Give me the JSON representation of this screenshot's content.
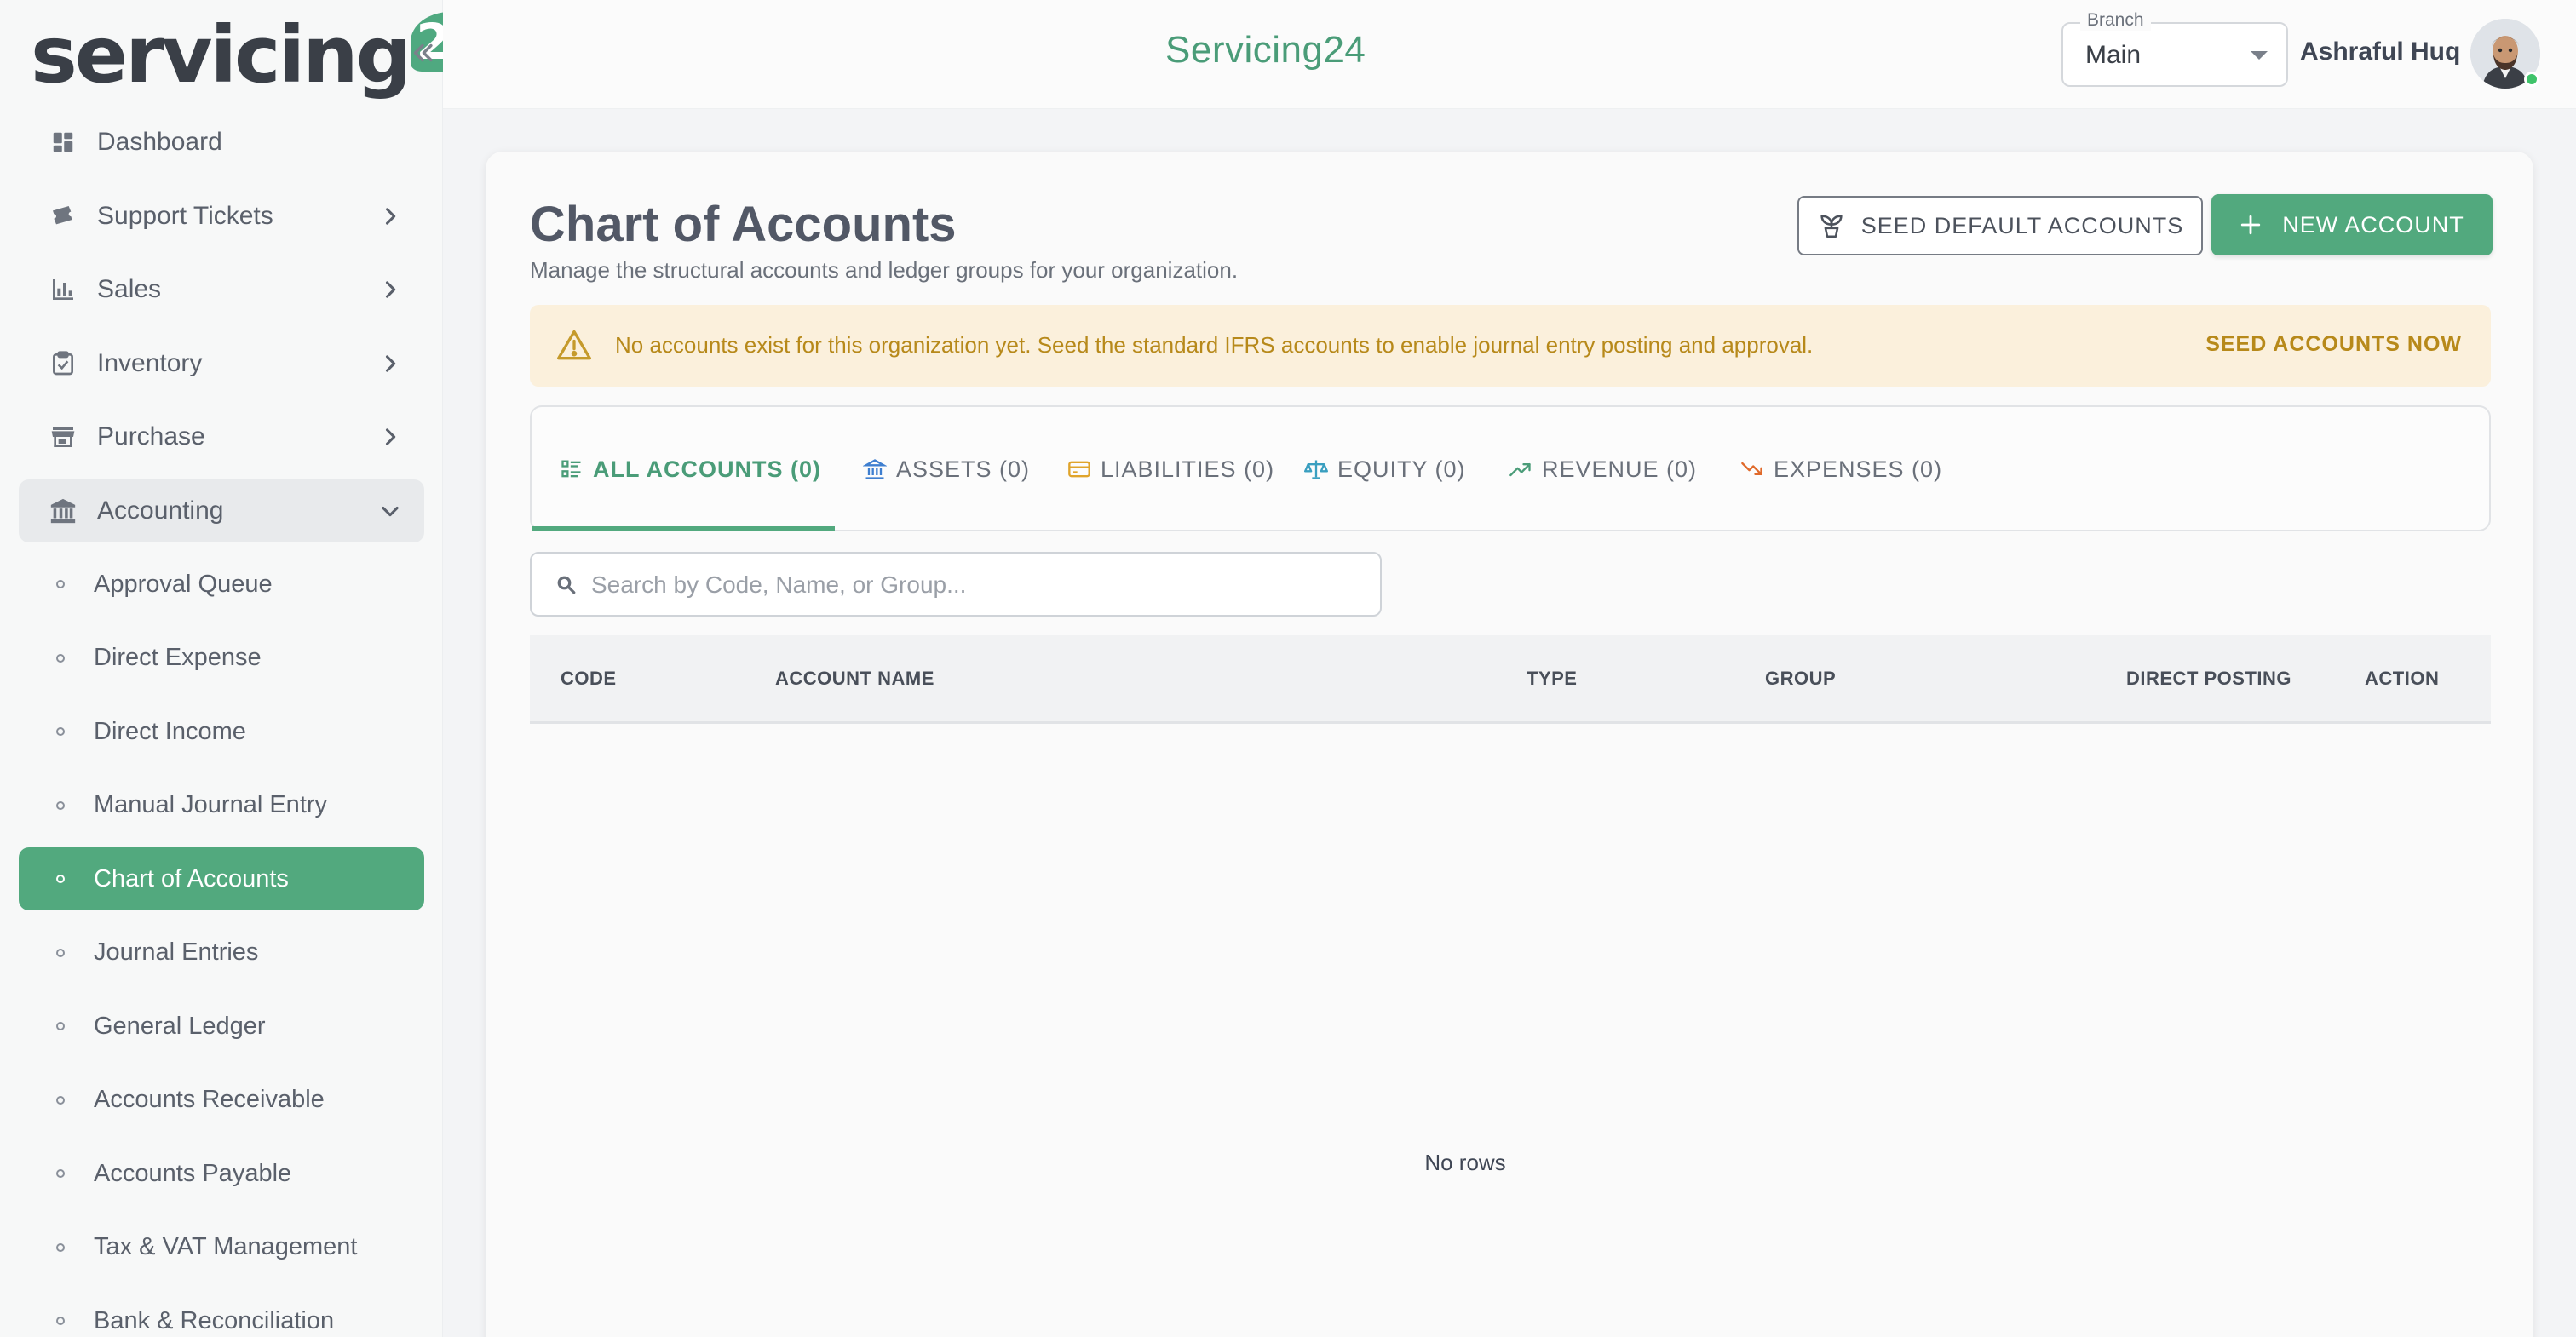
{
  "brand": {
    "logo_text": "servicing",
    "logo_badge": "24",
    "accent": "#52a97e"
  },
  "header": {
    "app_title": "Servicing24",
    "branch_label": "Branch",
    "branch_value": "Main",
    "user_name": "Ashraful Huq"
  },
  "sidebar": {
    "items": [
      {
        "label": "Dashboard",
        "icon": "dashboard-icon"
      },
      {
        "label": "Support Tickets",
        "icon": "ticket-icon"
      },
      {
        "label": "Sales",
        "icon": "bar-chart-icon"
      },
      {
        "label": "Inventory",
        "icon": "clipboard-check-icon"
      },
      {
        "label": "Purchase",
        "icon": "store-icon"
      },
      {
        "label": "Accounting",
        "icon": "bank-icon"
      }
    ],
    "accounting_sub": [
      "Approval Queue",
      "Direct Expense",
      "Direct Income",
      "Manual Journal Entry",
      "Chart of Accounts",
      "Journal Entries",
      "General Ledger",
      "Accounts Receivable",
      "Accounts Payable",
      "Tax & VAT Management",
      "Bank & Reconciliation"
    ]
  },
  "page": {
    "title": "Chart of Accounts",
    "subtitle": "Manage the structural accounts and ledger groups for your organization.",
    "seed_button": "SEED DEFAULT ACCOUNTS",
    "new_button": "NEW ACCOUNT"
  },
  "alert": {
    "text": "No accounts exist for this organization yet. Seed the standard IFRS accounts to enable journal entry posting and approval.",
    "action": "SEED ACCOUNTS NOW",
    "color": "#b7891a"
  },
  "tabs": [
    {
      "label": "ALL ACCOUNTS (0)",
      "icon": "list-icon"
    },
    {
      "label": "ASSETS (0)",
      "icon": "bank-icon"
    },
    {
      "label": "LIABILITIES (0)",
      "icon": "card-icon"
    },
    {
      "label": "EQUITY (0)",
      "icon": "scale-icon"
    },
    {
      "label": "REVENUE (0)",
      "icon": "trend-up-icon"
    },
    {
      "label": "EXPENSES (0)",
      "icon": "trend-down-icon"
    }
  ],
  "search": {
    "placeholder": "Search by Code, Name, or Group..."
  },
  "table": {
    "columns": [
      "CODE",
      "ACCOUNT NAME",
      "TYPE",
      "GROUP",
      "DIRECT POSTING",
      "ACTION"
    ],
    "empty_text": "No rows"
  }
}
